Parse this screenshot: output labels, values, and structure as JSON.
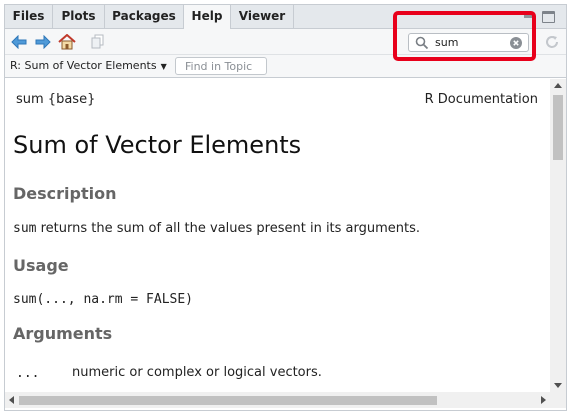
{
  "tabs": [
    {
      "label": "Files",
      "active": false
    },
    {
      "label": "Plots",
      "active": false
    },
    {
      "label": "Packages",
      "active": false
    },
    {
      "label": "Help",
      "active": true
    },
    {
      "label": "Viewer",
      "active": false
    }
  ],
  "toolbar": {
    "icons": [
      "back-arrow-icon",
      "forward-arrow-icon",
      "home-icon",
      "print-icon",
      "refresh-icon"
    ],
    "search": {
      "value": "sum",
      "placeholder": ""
    }
  },
  "topic_bar": {
    "topic_label": "R: Sum of Vector Elements",
    "find_placeholder": "Find in Topic"
  },
  "doc": {
    "name": "sum {base}",
    "source": "R Documentation",
    "title": "Sum of Vector Elements",
    "description_heading": "Description",
    "description_code": "sum",
    "description_text": " returns the sum of all the values present in its arguments.",
    "usage_heading": "Usage",
    "usage_code": "sum(..., na.rm = FALSE)",
    "arguments_heading": "Arguments",
    "arguments": [
      {
        "name": "...",
        "desc": "numeric or complex or logical vectors."
      }
    ]
  },
  "colors": {
    "highlight": "#e8001b",
    "accent_blue": "#4f9ad8",
    "home_red": "#c0392b"
  }
}
